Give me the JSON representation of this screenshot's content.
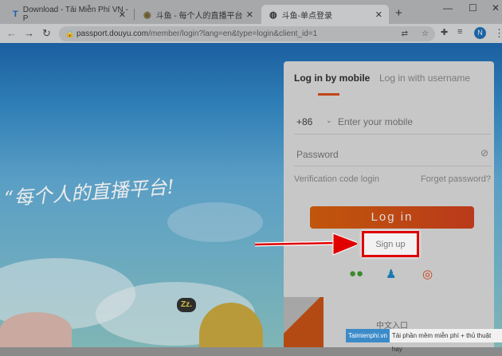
{
  "browser": {
    "tabs": [
      {
        "label": "Download - Tải Miễn Phí VN - P",
        "icon": "T"
      },
      {
        "label": "斗鱼 - 每个人的直播平台"
      },
      {
        "label": "斗鱼-单点登录",
        "active": true
      }
    ],
    "new_tab": "+",
    "url_host": "passport.douyu.com",
    "url_path": "/member/login?lang=en&type=login&client_id=1",
    "profile_initial": "N",
    "window_controls": {
      "minimize": "—",
      "maximize": "☐",
      "close": "✕"
    }
  },
  "hero": {
    "slogan": "“每个人的直播平台!",
    "zz": "Zz."
  },
  "login": {
    "tab_mobile": "Log in by mobile",
    "tab_username": "Log in with username",
    "country_code": "+86",
    "mobile_placeholder": "Enter your mobile",
    "password_placeholder": "Password",
    "verification_link": "Verification code login",
    "forgot_link": "Forget password?",
    "login_button": "Log in",
    "signup_button": "Sign up",
    "chinese_entry": "中文入口",
    "accent": "#c2461a"
  },
  "watermark": {
    "brand": "Taimienphi.vn",
    "tagline": "Tải phần mềm miễn phí + thủ thuật hay"
  }
}
